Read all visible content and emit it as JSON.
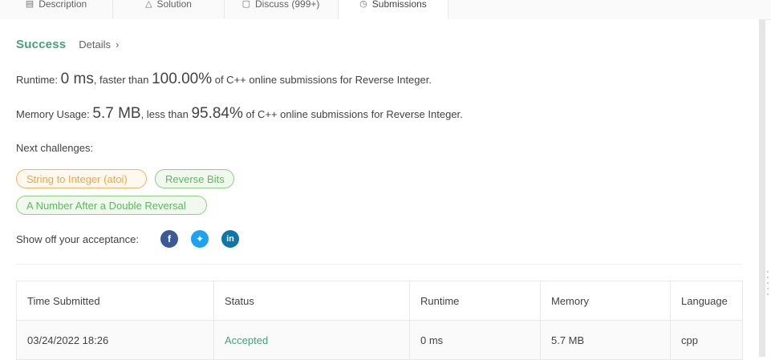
{
  "tabs": [
    {
      "label": "Description",
      "icon": "document-icon"
    },
    {
      "label": "Solution",
      "icon": "flask-icon"
    },
    {
      "label": "Discuss (999+)",
      "icon": "chat-icon"
    },
    {
      "label": "Submissions",
      "icon": "clock-icon",
      "active": true
    }
  ],
  "result": {
    "status": "Success",
    "details_label": "Details"
  },
  "runtime": {
    "label": "Runtime: ",
    "value": "0 ms",
    "comparison": ", faster than ",
    "percent": "100.00%",
    "suffix": " of C++ online submissions for Reverse Integer."
  },
  "memory": {
    "label": "Memory Usage: ",
    "value": "5.7 MB",
    "comparison": ", less than ",
    "percent": "95.84%",
    "suffix": " of C++ online submissions for Reverse Integer."
  },
  "next_challenges": {
    "label": "Next challenges:",
    "items": [
      {
        "label": "String to Integer (atoi)",
        "difficulty": "medium"
      },
      {
        "label": "Reverse Bits",
        "difficulty": "easy"
      },
      {
        "label": "A Number After a Double Reversal",
        "difficulty": "easy"
      }
    ]
  },
  "share": {
    "label": "Show off your acceptance:",
    "icons": [
      "facebook-icon",
      "twitter-icon",
      "linkedin-icon"
    ]
  },
  "table": {
    "headers": [
      "Time Submitted",
      "Status",
      "Runtime",
      "Memory",
      "Language"
    ],
    "rows": [
      [
        "03/24/2022 18:26",
        "Accepted",
        "0 ms",
        "5.7 MB",
        "cpp"
      ]
    ]
  },
  "colors": {
    "success": "#45a07d",
    "medium": "#f0a541",
    "easy": "#5cb85c"
  }
}
